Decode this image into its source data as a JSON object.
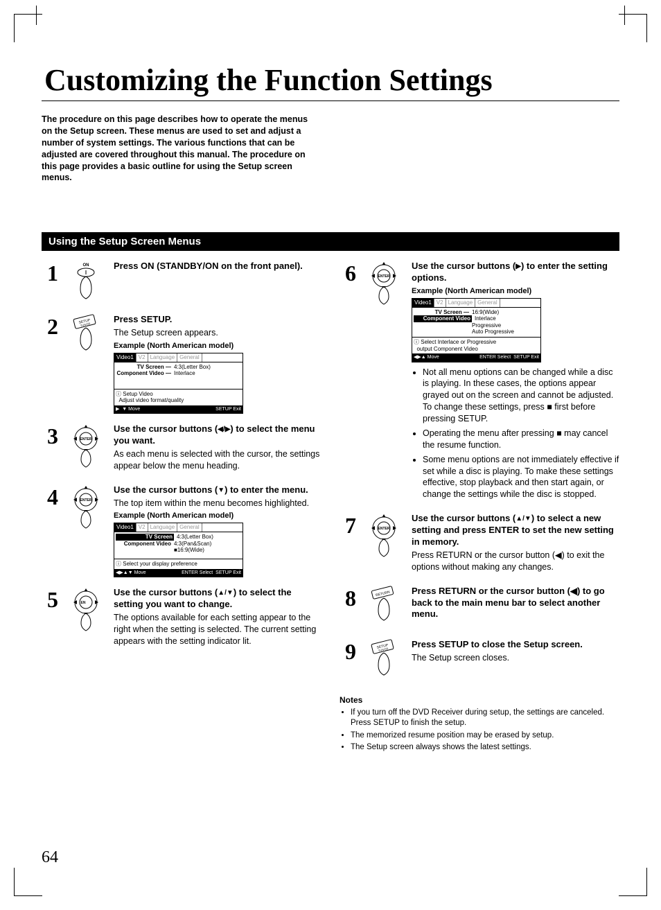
{
  "page_number": "64",
  "title": "Customizing the Function Settings",
  "intro": "The procedure on this page describes how to operate the menus on the Setup screen. These menus are used to set and adjust a number of system settings. The various functions that can be adjusted are covered throughout this manual. The procedure on this page provides a basic outline for using the Setup screen menus.",
  "section_heading": "Using the Setup Screen Menus",
  "steps": {
    "s1": {
      "title": "Press ON (STANDBY/ON on the front panel)."
    },
    "s2": {
      "title": "Press SETUP.",
      "text": "The Setup screen appears.",
      "example": "Example (North American model)"
    },
    "s3": {
      "title_a": "Use the cursor buttons (",
      "title_b": ") to select the menu you want.",
      "arrows": "◀/▶",
      "text": "As each menu is selected with the cursor, the settings appear below the menu heading."
    },
    "s4": {
      "title_a": "Use the cursor buttons (",
      "title_b": ") to enter the menu.",
      "arrows": "▼",
      "text": "The top item within the menu becomes highlighted.",
      "example": "Example (North American model)"
    },
    "s5": {
      "title_a": "Use the cursor buttons (",
      "title_b": ") to select the setting you want to change.",
      "arrows": "▲/▼",
      "text": "The options available for each setting appear to the right when the setting is selected. The current setting appears with the setting indicator lit."
    },
    "s6": {
      "title_a": "Use the cursor buttons (",
      "title_b": ")  to enter the setting options.",
      "arrows": "▶",
      "example": "Example (North American model)",
      "bullets": [
        "Not all menu options can be changed while a disc is playing. In these cases, the options appear grayed out on the screen and cannot be adjusted. To change these settings, press ■ first before pressing SETUP.",
        "Operating the menu after pressing ■ may cancel the resume function.",
        "Some menu options are not immediately effective if set while a disc is playing. To make these settings effective, stop playback and then start again, or change the settings while the disc is stopped."
      ]
    },
    "s7": {
      "title_a": "Use the cursor buttons (",
      "title_b": ") to select a new  setting and press ENTER to set the new setting in memory.",
      "arrows": "▲/▼",
      "text": "Press RETURN or the cursor button (◀) to exit the options without making any changes."
    },
    "s8": {
      "title": "Press RETURN or the cursor button (◀) to go back to the main menu bar to select another menu."
    },
    "s9": {
      "title": "Press SETUP to close the Setup screen.",
      "text": "The Setup screen closes."
    }
  },
  "osd": {
    "tabs": {
      "video1": "Video1",
      "v2": "V2",
      "language": "Language",
      "general": "General"
    },
    "a": {
      "row1_l": "TV Screen —",
      "row1_r": "4:3(Letter Box)",
      "row2_l": "Component Video —",
      "row2_r": "Interlace",
      "hint1": "Setup Video",
      "hint2": "Adjust video format/quality",
      "foot_move": "Move",
      "foot_setup": "SETUP",
      "foot_exit": "Exit"
    },
    "b": {
      "row1_l": "TV Screen",
      "row1_r1": "4:3(Letter Box)",
      "row1_r2": "4:3(Pan&Scan)",
      "row1_r3": "16:9(Wide)",
      "row2_l": "Component Video",
      "hint": "Select your display preference",
      "foot_move": "Move",
      "foot_enter": "ENTER",
      "foot_select": "Select",
      "foot_setup": "SETUP",
      "foot_exit": "Exit"
    },
    "c": {
      "row1_l": "TV Screen —",
      "row1_r": "16:9(Wide)",
      "row2_l": "Component Video",
      "opt1": "Interlace",
      "opt2": "Progressive",
      "opt3": "Auto Progressive",
      "hint1": "Select Interlace or Progressive",
      "hint2": "output Component Video",
      "foot_move": "Move",
      "foot_enter": "ENTER",
      "foot_select": "Select",
      "foot_setup": "SETUP",
      "foot_exit": "Exit"
    }
  },
  "notes_heading": "Notes",
  "notes": [
    "If you  turn off the DVD Receiver during setup, the settings are canceled. Press SETUP to finish the setup.",
    "The memorized resume position may be erased by setup.",
    "The Setup screen always shows the latest settings."
  ],
  "icons": {
    "on_label": "ON",
    "enter_label": "ENTER",
    "setup_label": "SETUP\nTV/VCR",
    "return_label": "RETURN"
  }
}
